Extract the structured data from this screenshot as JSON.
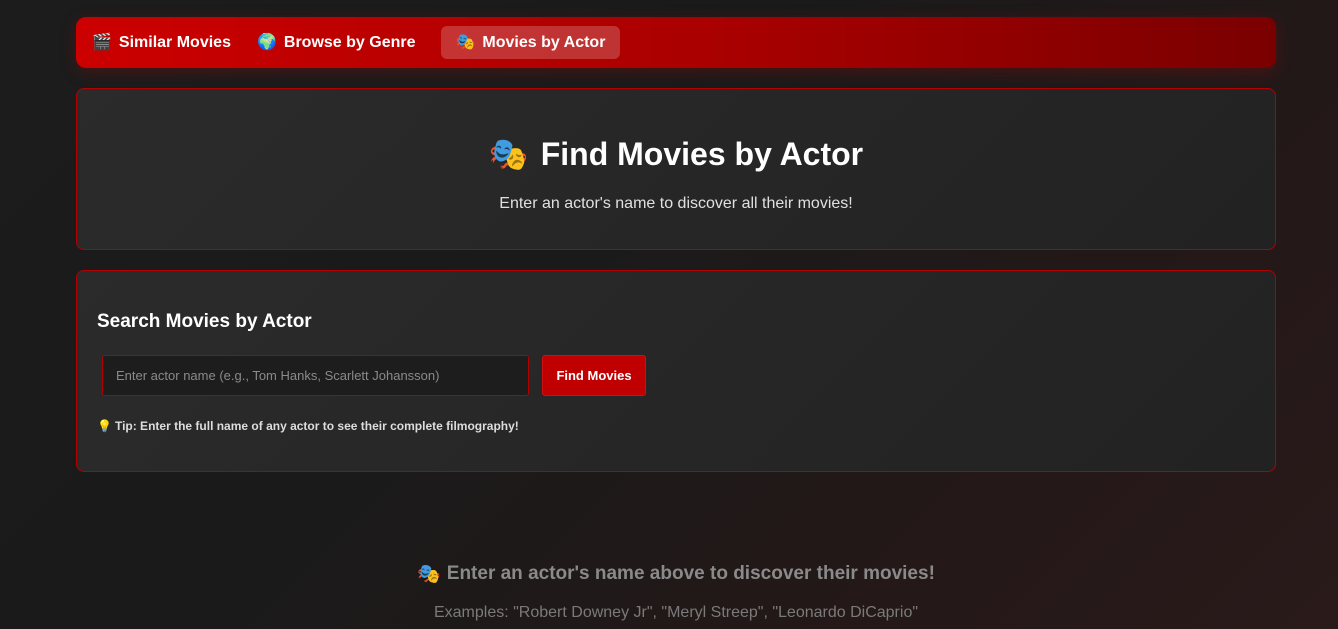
{
  "nav": {
    "items": [
      {
        "icon": "🎬",
        "icon_name": "clapperboard-icon",
        "label": "Similar Movies",
        "active": false
      },
      {
        "icon": "🌍",
        "icon_name": "globe-icon",
        "label": "Browse by Genre",
        "active": false
      },
      {
        "icon": "🎭",
        "icon_name": "theater-masks-icon",
        "label": "Movies by Actor",
        "active": true
      }
    ]
  },
  "hero": {
    "icon": "🎭",
    "title": "Find Movies by Actor",
    "subtitle": "Enter an actor's name to discover all their movies!"
  },
  "search": {
    "heading": "Search Movies by Actor",
    "placeholder": "Enter actor name (e.g., Tom Hanks, Scarlett Johansson)",
    "value": "",
    "button_label": "Find Movies",
    "tip_icon": "💡",
    "tip": "Tip: Enter the full name of any actor to see their complete filmography!"
  },
  "empty_state": {
    "icon": "🎭",
    "title": "Enter an actor's name above to discover their movies!",
    "examples": "Examples: \"Robert Downey Jr\", \"Meryl Streep\", \"Leonardo DiCaprio\""
  },
  "colors": {
    "accent": "#cc0000",
    "border": "#b30000",
    "background": "#1c1c1c"
  }
}
